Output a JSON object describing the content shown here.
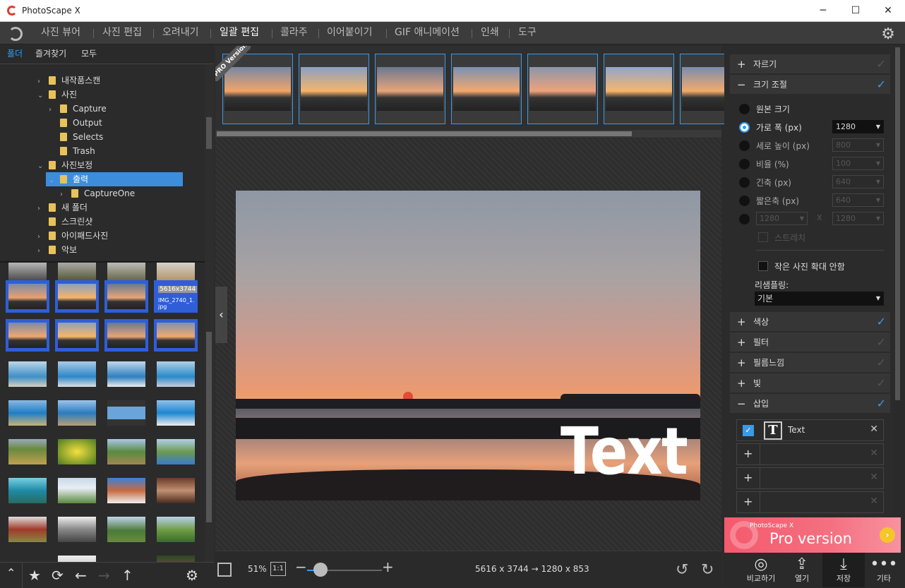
{
  "window": {
    "title": "PhotoScape X",
    "minimize": "─",
    "maximize": "☐",
    "close": "✕"
  },
  "menu": {
    "items": [
      "사진 뷰어",
      "사진 편집",
      "오려내기",
      "일괄 편집",
      "콜라주",
      "이어붙이기",
      "GIF 애니메이션",
      "인쇄",
      "도구"
    ],
    "active": "일괄 편집"
  },
  "left_tabs": [
    "폴더",
    "즐겨찾기",
    "모두"
  ],
  "tree": [
    {
      "label": "내작품스캔",
      "arrow": "›"
    },
    {
      "label": "사진",
      "arrow": "⌄"
    },
    {
      "label": "Capture",
      "arrow": "›"
    },
    {
      "label": "Output",
      "arrow": ""
    },
    {
      "label": "Selects",
      "arrow": ""
    },
    {
      "label": "Trash",
      "arrow": ""
    },
    {
      "label": "사진보정",
      "arrow": "⌄"
    },
    {
      "label": "출력",
      "arrow": "⌄"
    },
    {
      "label": "CaptureOne",
      "arrow": "›"
    },
    {
      "label": "새 폴더",
      "arrow": "›"
    },
    {
      "label": "스크린샷",
      "arrow": ""
    },
    {
      "label": "아이패드사진",
      "arrow": "›"
    },
    {
      "label": "악보",
      "arrow": "›"
    }
  ],
  "thumb_overlay": {
    "size": "5616x3744",
    "name": "IMG_2740_1.jpg"
  },
  "pro_ribbon": "PRO Version",
  "photo_text": "Text",
  "status": {
    "zoom": "51%",
    "one_to_one": "1:1",
    "dimensions": "5616 x 3744 → 1280 x 853",
    "minus": "−",
    "plus": "+"
  },
  "panel": {
    "sections_top": [
      {
        "label": "자르기",
        "expanded": false,
        "checked": false
      },
      {
        "label": "크기 조절",
        "expanded": true,
        "checked": true
      }
    ],
    "resize_options": [
      {
        "label": "원본 크기",
        "selected": false,
        "value": ""
      },
      {
        "label": "가로 폭 (px)",
        "selected": true,
        "value": "1280"
      },
      {
        "label": "세로 높이 (px)",
        "selected": false,
        "value": "800"
      },
      {
        "label": "비율 (%)",
        "selected": false,
        "value": "100"
      },
      {
        "label": "긴축 (px)",
        "selected": false,
        "value": "640"
      },
      {
        "label": "짧은축 (px)",
        "selected": false,
        "value": "640"
      }
    ],
    "custom_w": "1280",
    "custom_h": "1280",
    "custom_x": "X",
    "stretch": "스트레치",
    "no_upscale": "작은 사진 확대 안함",
    "resampling_label": "리샘플링:",
    "resampling_value": "기본",
    "sections_bottom": [
      {
        "label": "색상",
        "expanded": false,
        "checked": true
      },
      {
        "label": "필터",
        "expanded": false,
        "checked": false
      },
      {
        "label": "필름느낌",
        "expanded": false,
        "checked": false
      },
      {
        "label": "빛",
        "expanded": false,
        "checked": false
      },
      {
        "label": "삽입",
        "expanded": true,
        "checked": true
      }
    ],
    "insert_text_label": "Text"
  },
  "banner": {
    "small": "PhotoScape X",
    "pro": "Pro",
    "version": " version"
  },
  "bottom_buttons": [
    {
      "label": "비교하기",
      "icon": "compare-icon"
    },
    {
      "label": "열기",
      "icon": "upload-icon"
    },
    {
      "label": "저장",
      "icon": "download-icon"
    },
    {
      "label": "기타",
      "icon": "more-icon"
    }
  ],
  "colors": {
    "accent": "#3a9ae8",
    "selection": "#2f5ed8",
    "banner": "#f45a6d"
  }
}
